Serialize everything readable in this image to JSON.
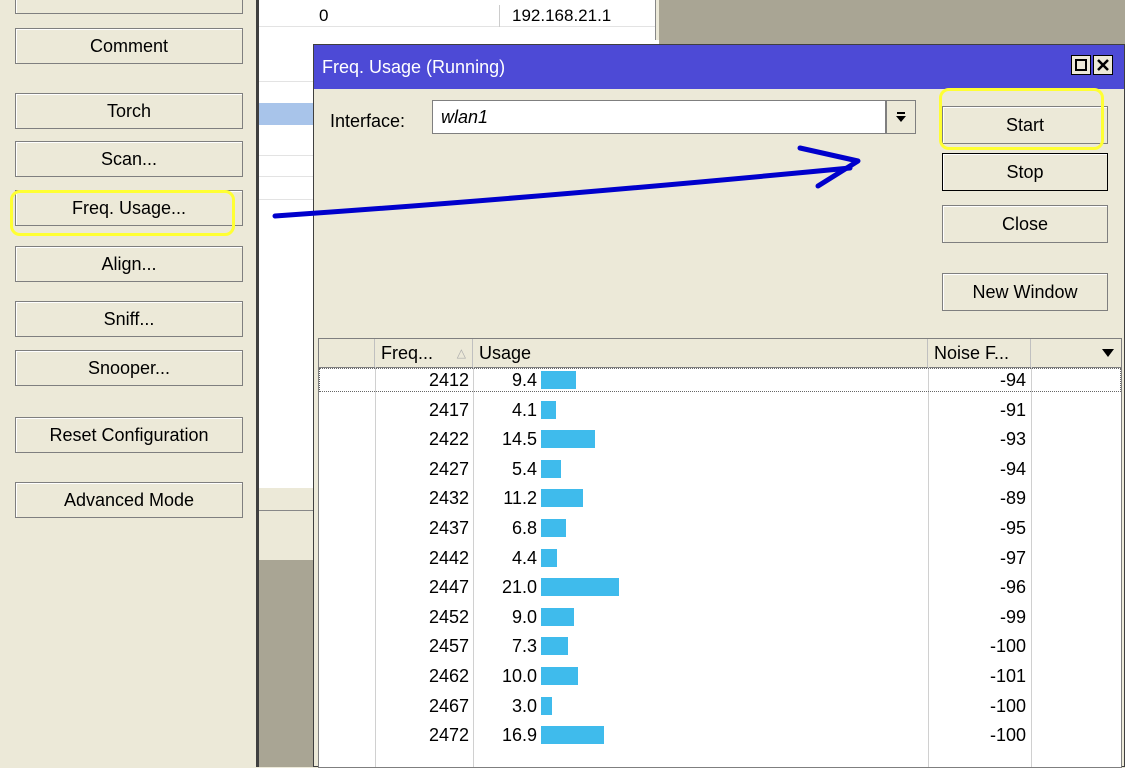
{
  "left_panel": {
    "buttons": [
      {
        "label": "Comment"
      },
      {
        "label": "Torch"
      },
      {
        "label": "Scan..."
      },
      {
        "label": "Freq. Usage..."
      },
      {
        "label": "Align..."
      },
      {
        "label": "Sniff..."
      },
      {
        "label": "Snooper..."
      },
      {
        "label": "Reset Configuration"
      },
      {
        "label": "Advanced Mode"
      }
    ]
  },
  "background_list": {
    "row0": {
      "col1": "0",
      "col2": "192.168.21.1"
    }
  },
  "window": {
    "title": "Freq. Usage (Running)",
    "interface_label": "Interface:",
    "interface_value": "wlan1",
    "buttons": {
      "start": "Start",
      "stop": "Stop",
      "close": "Close",
      "new_window": "New Window"
    },
    "table": {
      "headers": {
        "freq": "Freq...",
        "usage": "Usage",
        "noise": "Noise F..."
      },
      "rows": [
        {
          "freq": "2412",
          "usage": "9.4",
          "noise": "-94"
        },
        {
          "freq": "2417",
          "usage": "4.1",
          "noise": "-91"
        },
        {
          "freq": "2422",
          "usage": "14.5",
          "noise": "-93"
        },
        {
          "freq": "2427",
          "usage": "5.4",
          "noise": "-94"
        },
        {
          "freq": "2432",
          "usage": "11.2",
          "noise": "-89"
        },
        {
          "freq": "2437",
          "usage": "6.8",
          "noise": "-95"
        },
        {
          "freq": "2442",
          "usage": "4.4",
          "noise": "-97"
        },
        {
          "freq": "2447",
          "usage": "21.0",
          "noise": "-96"
        },
        {
          "freq": "2452",
          "usage": "9.0",
          "noise": "-99"
        },
        {
          "freq": "2457",
          "usage": "7.3",
          "noise": "-100"
        },
        {
          "freq": "2462",
          "usage": "10.0",
          "noise": "-101"
        },
        {
          "freq": "2467",
          "usage": "3.0",
          "noise": "-100"
        },
        {
          "freq": "2472",
          "usage": "16.9",
          "noise": "-100"
        }
      ]
    }
  },
  "colors": {
    "titlebar": "#4d4ad6",
    "usage_bar": "#3fbbec",
    "highlight": "#ffff33",
    "arrow": "#0000cc"
  }
}
